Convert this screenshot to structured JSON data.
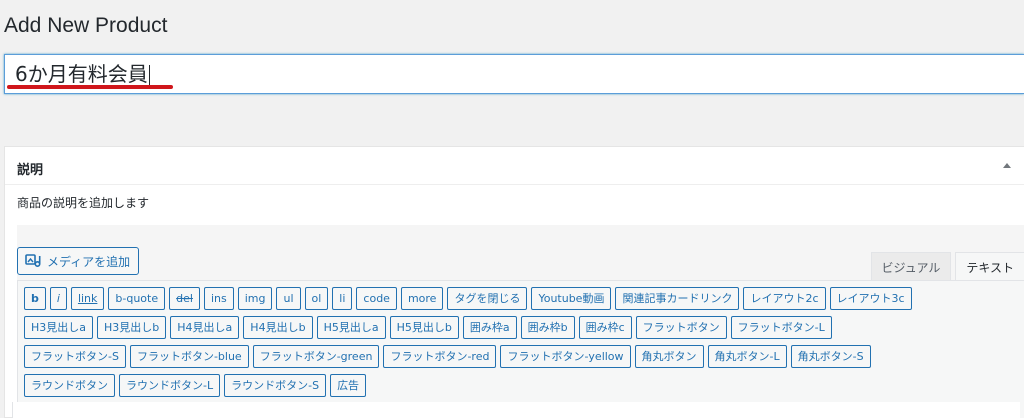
{
  "page": {
    "title": "Add New Product"
  },
  "title_field": {
    "value": "6か月有料会員"
  },
  "description_box": {
    "heading": "説明",
    "helper_text": "商品の説明を追加します",
    "media_button_label": "メディアを追加",
    "tabs": [
      {
        "label": "ビジュアル",
        "active": false
      },
      {
        "label": "テキスト",
        "active": true
      }
    ],
    "quicktags": {
      "row1": [
        "b",
        "i",
        "link",
        "b-quote",
        "del",
        "ins",
        "img",
        "ul",
        "ol",
        "li",
        "code",
        "more",
        "タグを閉じる",
        "Youtube動画",
        "関連記事カードリンク",
        "レイアウト2c",
        "レイアウト3c"
      ],
      "row2": [
        "H3見出しa",
        "H3見出しb",
        "H4見出しa",
        "H4見出しb",
        "H5見出しa",
        "H5見出しb",
        "囲み枠a",
        "囲み枠b",
        "囲み枠c",
        "フラットボタン",
        "フラットボタン-L"
      ],
      "row3": [
        "フラットボタン-S",
        "フラットボタン-blue",
        "フラットボタン-green",
        "フラットボタン-red",
        "フラットボタン-yellow",
        "角丸ボタン",
        "角丸ボタン-L",
        "角丸ボタン-S"
      ],
      "row4": [
        "ラウンドボタン",
        "ラウンドボタン-L",
        "ラウンドボタン-S",
        "広告"
      ]
    }
  },
  "colors": {
    "accent": "#2271b1",
    "underline": "#d0161b"
  },
  "icons": {
    "media": "media-add-icon",
    "toggle": "triangle-up-icon"
  }
}
